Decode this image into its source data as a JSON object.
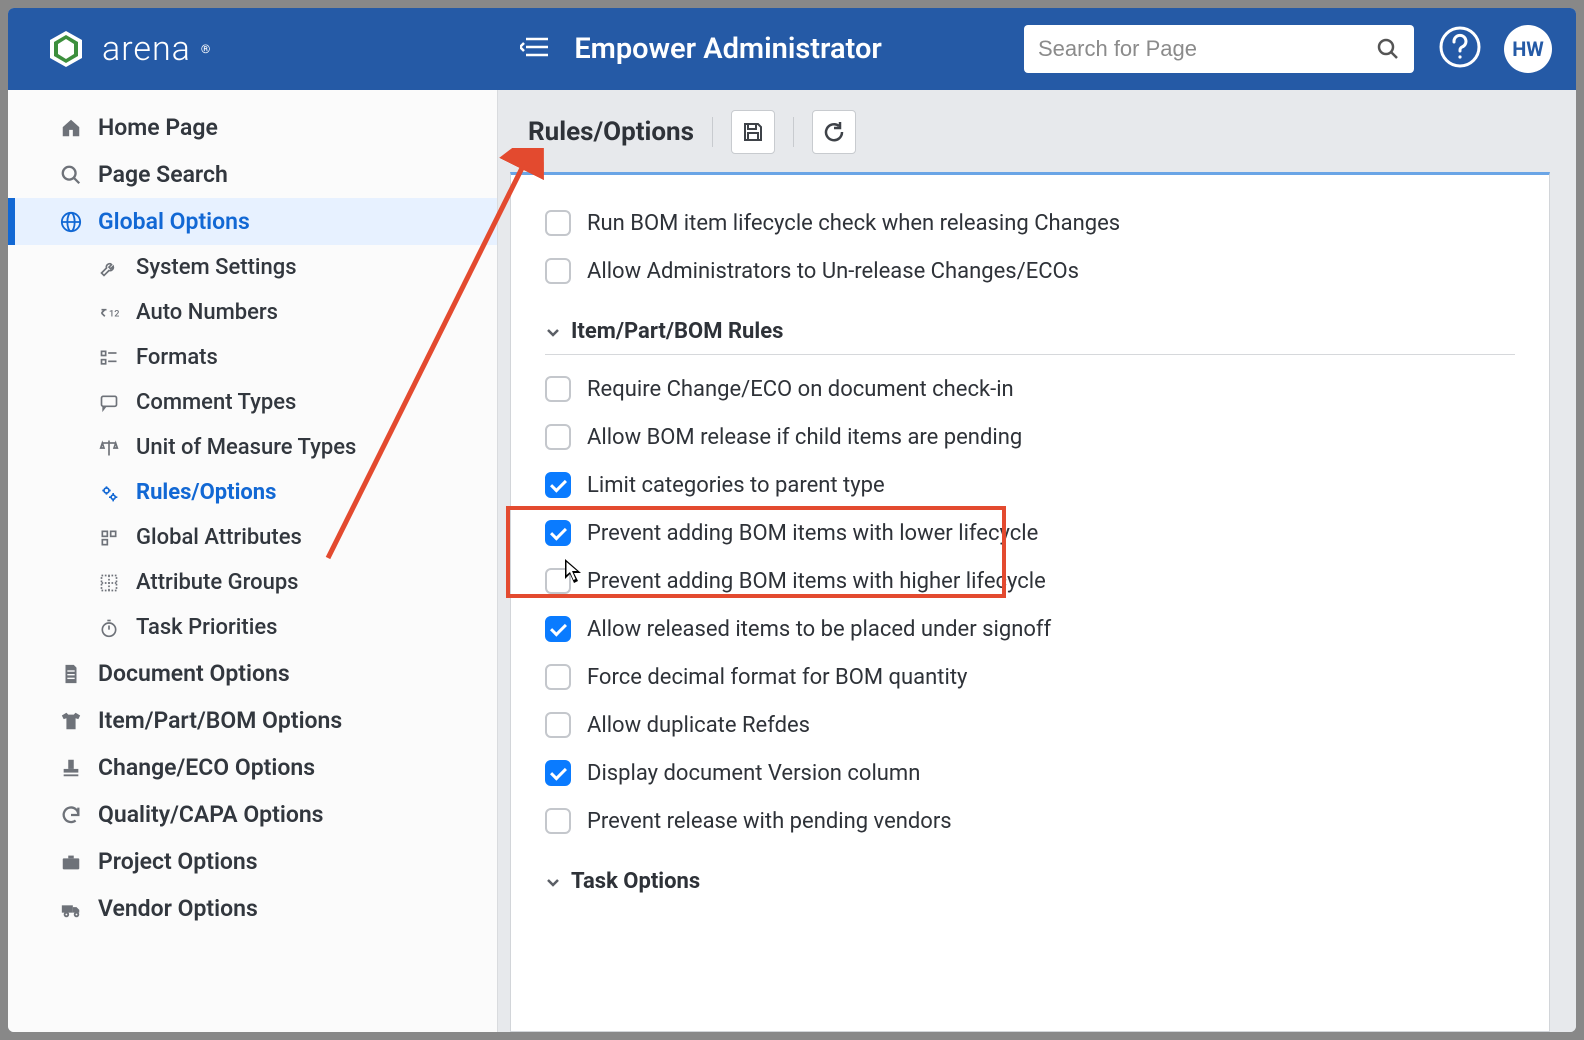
{
  "header": {
    "brand": "arena",
    "page_title": "Empower Administrator",
    "search_placeholder": "Search for Page",
    "avatar_initials": "HW"
  },
  "sidebar": {
    "items": [
      {
        "label": "Home Page"
      },
      {
        "label": "Page Search"
      },
      {
        "label": "Global Options"
      },
      {
        "label": "System Settings"
      },
      {
        "label": "Auto Numbers"
      },
      {
        "label": "Formats"
      },
      {
        "label": "Comment Types"
      },
      {
        "label": "Unit of Measure Types"
      },
      {
        "label": "Rules/Options"
      },
      {
        "label": "Global Attributes"
      },
      {
        "label": "Attribute Groups"
      },
      {
        "label": "Task Priorities"
      },
      {
        "label": "Document Options"
      },
      {
        "label": "Item/Part/BOM Options"
      },
      {
        "label": "Change/ECO Options"
      },
      {
        "label": "Quality/CAPA Options"
      },
      {
        "label": "Project Options"
      },
      {
        "label": "Vendor Options"
      }
    ]
  },
  "content": {
    "title": "Rules/Options",
    "checks_top": [
      {
        "label": "Run BOM item lifecycle check when releasing Changes",
        "on": false
      },
      {
        "label": "Allow Administrators to Un-release Changes/ECOs",
        "on": false
      }
    ],
    "section1": "Item/Part/BOM Rules",
    "checks_s1": [
      {
        "label": "Require Change/ECO on document check-in",
        "on": false
      },
      {
        "label": "Allow BOM release if child items are pending",
        "on": false
      },
      {
        "label": "Limit categories to parent type",
        "on": true
      },
      {
        "label": "Prevent adding BOM items with lower lifecycle",
        "on": true
      },
      {
        "label": "Prevent adding BOM items with higher lifecycle",
        "on": false
      },
      {
        "label": "Allow released items to be placed under signoff",
        "on": true
      },
      {
        "label": "Force decimal format for BOM quantity",
        "on": false
      },
      {
        "label": "Allow duplicate Refdes",
        "on": false
      },
      {
        "label": "Display document Version column",
        "on": true
      },
      {
        "label": "Prevent release with pending vendors",
        "on": false
      }
    ],
    "section2": "Task Options"
  }
}
